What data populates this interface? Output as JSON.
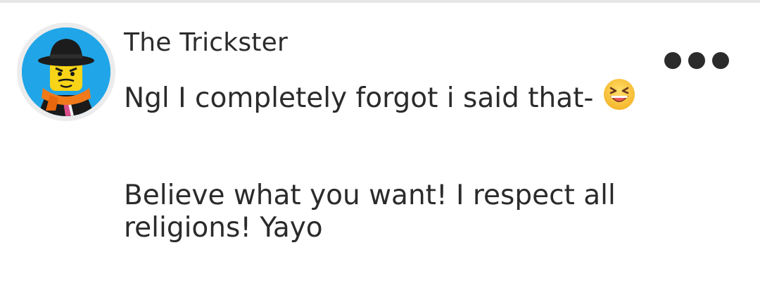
{
  "comment": {
    "author": "The Trickster",
    "avatar_icon": "lego-minifigure-avatar",
    "more_icon": "more-dots-icon",
    "line1_text": "Ngl I completely forgot i said that-",
    "emoji_icon": "laughing-face-emoji",
    "line2_text": "Believe what you want! I respect all religions! Yayo"
  },
  "colors": {
    "text": "#2b2b2b",
    "avatar_bg": "#20a6e8",
    "divider": "#e6e6e6"
  }
}
